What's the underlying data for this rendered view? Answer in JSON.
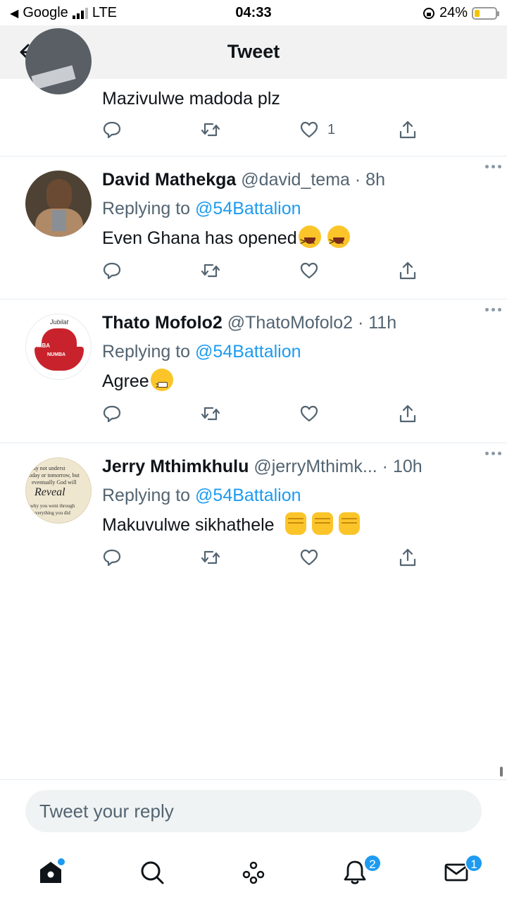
{
  "status_bar": {
    "carrier": "Google",
    "network": "LTE",
    "time": "04:33",
    "battery_percent": "24%",
    "battery_level": 0.24,
    "colors": {
      "battery": "#f5c400"
    }
  },
  "header": {
    "title": "Tweet",
    "back_icon": "arrow-left-icon"
  },
  "colors": {
    "accent": "#1d9bf0",
    "text": "#0f1419",
    "muted": "#536471",
    "divider": "#e6ecf0"
  },
  "tweets": [
    {
      "text": "Mazivulwe madoda plz",
      "like_count": "1"
    },
    {
      "name": "David Mathekga",
      "handle": "@david_tema",
      "time": "· 8h",
      "replying_prefix": "Replying to",
      "replying_to": "@54Battalion",
      "text": "Even Ghana has opened",
      "emojis": [
        "grinning-squinting-face",
        "grinning-squinting-face"
      ]
    },
    {
      "name": "Thato Mofolo2",
      "handle": "@ThatoMofolo2",
      "time": "· 11h",
      "replying_prefix": "Replying to",
      "replying_to": "@54Battalion",
      "text": "Agree",
      "emojis": [
        "face-with-steam"
      ],
      "avatar_text": [
        "Jubilat",
        "INUMBA",
        "NUMBA"
      ]
    },
    {
      "name": "Jerry Mthimkhulu",
      "handle": "@jerryMthimk...",
      "time": "· 10h",
      "replying_prefix": "Replying to",
      "replying_to": "@54Battalion",
      "text": "Makuvulwe sikhathele",
      "emojis": [
        "raised-fist",
        "raised-fist",
        "raised-fist"
      ],
      "avatar_text": [
        "may not underst",
        "today or tomorrow, but",
        "eventually God will",
        "Reveal",
        "why you went through",
        "everything you did"
      ]
    }
  ],
  "reply_bar": {
    "placeholder": "Tweet your reply"
  },
  "tabbar": {
    "items": [
      {
        "icon": "home-icon",
        "active": true,
        "has_dot": true
      },
      {
        "icon": "search-icon"
      },
      {
        "icon": "spaces-icon"
      },
      {
        "icon": "bell-icon",
        "badge": "2"
      },
      {
        "icon": "mail-icon",
        "badge": "1"
      }
    ]
  }
}
